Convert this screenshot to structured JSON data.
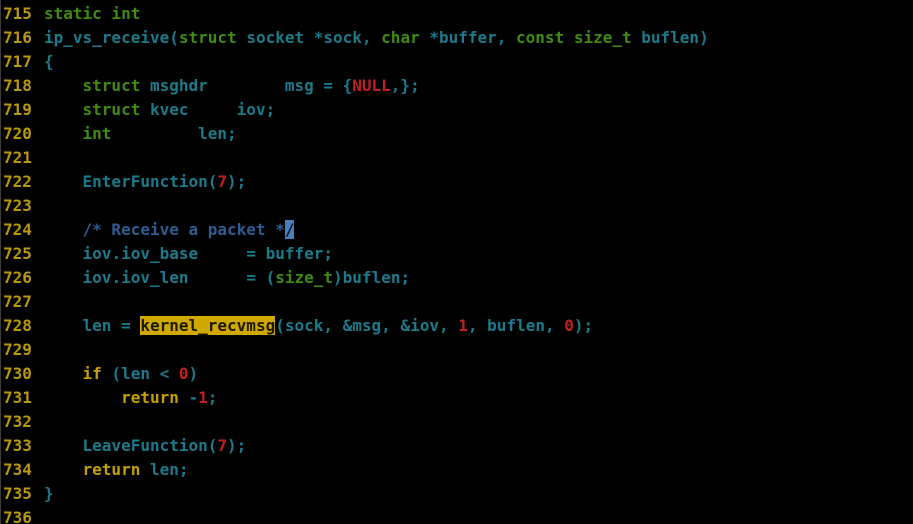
{
  "editor": {
    "app_kind": "terminal-code-viewer",
    "background_color": "#000000",
    "search_highlight_color": "#d0a800",
    "cursor_color": "#4a7ebb",
    "linenumber_color": "#b8980f",
    "search_term": "kernel_recvmsg",
    "cursor": {
      "line": 724,
      "column_char": "/"
    }
  },
  "lines": [
    {
      "num": "715",
      "tokens": [
        {
          "t": "static int",
          "c": "kw-type"
        }
      ]
    },
    {
      "num": "716",
      "tokens": [
        {
          "t": "ip_vs_receive",
          "c": "ident"
        },
        {
          "t": "(",
          "c": "punct"
        },
        {
          "t": "struct",
          "c": "kw-type"
        },
        {
          "t": " ",
          "c": "plain"
        },
        {
          "t": "socket",
          "c": "ident"
        },
        {
          "t": " *",
          "c": "plain"
        },
        {
          "t": "sock",
          "c": "ident"
        },
        {
          "t": ", ",
          "c": "punct"
        },
        {
          "t": "char",
          "c": "kw-type"
        },
        {
          "t": " *",
          "c": "plain"
        },
        {
          "t": "buffer",
          "c": "ident"
        },
        {
          "t": ", ",
          "c": "punct"
        },
        {
          "t": "const size_t",
          "c": "kw-type"
        },
        {
          "t": " ",
          "c": "plain"
        },
        {
          "t": "buflen",
          "c": "ident"
        },
        {
          "t": ")",
          "c": "punct"
        }
      ]
    },
    {
      "num": "717",
      "tokens": [
        {
          "t": "{",
          "c": "punct"
        }
      ]
    },
    {
      "num": "718",
      "tokens": [
        {
          "t": "    ",
          "c": "plain"
        },
        {
          "t": "struct",
          "c": "kw-type"
        },
        {
          "t": " ",
          "c": "plain"
        },
        {
          "t": "msghdr",
          "c": "ident"
        },
        {
          "t": "        ",
          "c": "plain"
        },
        {
          "t": "msg",
          "c": "ident"
        },
        {
          "t": " = {",
          "c": "punct"
        },
        {
          "t": "NULL",
          "c": "num"
        },
        {
          "t": ",};",
          "c": "punct"
        }
      ]
    },
    {
      "num": "719",
      "tokens": [
        {
          "t": "    ",
          "c": "plain"
        },
        {
          "t": "struct",
          "c": "kw-type"
        },
        {
          "t": " ",
          "c": "plain"
        },
        {
          "t": "kvec",
          "c": "ident"
        },
        {
          "t": "     ",
          "c": "plain"
        },
        {
          "t": "iov",
          "c": "ident"
        },
        {
          "t": ";",
          "c": "punct"
        }
      ]
    },
    {
      "num": "720",
      "tokens": [
        {
          "t": "    ",
          "c": "plain"
        },
        {
          "t": "int",
          "c": "kw-type"
        },
        {
          "t": "         ",
          "c": "plain"
        },
        {
          "t": "len",
          "c": "ident"
        },
        {
          "t": ";",
          "c": "punct"
        }
      ]
    },
    {
      "num": "721",
      "tokens": []
    },
    {
      "num": "722",
      "tokens": [
        {
          "t": "    ",
          "c": "plain"
        },
        {
          "t": "EnterFunction",
          "c": "ident"
        },
        {
          "t": "(",
          "c": "punct"
        },
        {
          "t": "7",
          "c": "num"
        },
        {
          "t": ");",
          "c": "punct"
        }
      ]
    },
    {
      "num": "723",
      "tokens": []
    },
    {
      "num": "724",
      "tokens": [
        {
          "t": "    ",
          "c": "plain"
        },
        {
          "t": "/* Receive a packet *",
          "c": "comment"
        },
        {
          "t": "/",
          "c": "cursor"
        }
      ]
    },
    {
      "num": "725",
      "tokens": [
        {
          "t": "    ",
          "c": "plain"
        },
        {
          "t": "iov",
          "c": "ident"
        },
        {
          "t": ".",
          "c": "punct"
        },
        {
          "t": "iov_base",
          "c": "ident"
        },
        {
          "t": "     = ",
          "c": "punct"
        },
        {
          "t": "buffer",
          "c": "ident"
        },
        {
          "t": ";",
          "c": "punct"
        }
      ]
    },
    {
      "num": "726",
      "tokens": [
        {
          "t": "    ",
          "c": "plain"
        },
        {
          "t": "iov",
          "c": "ident"
        },
        {
          "t": ".",
          "c": "punct"
        },
        {
          "t": "iov_len",
          "c": "ident"
        },
        {
          "t": "      = (",
          "c": "punct"
        },
        {
          "t": "size_t",
          "c": "kw-type"
        },
        {
          "t": ")",
          "c": "punct"
        },
        {
          "t": "buflen",
          "c": "ident"
        },
        {
          "t": ";",
          "c": "punct"
        }
      ]
    },
    {
      "num": "727",
      "tokens": []
    },
    {
      "num": "728",
      "tokens": [
        {
          "t": "    ",
          "c": "plain"
        },
        {
          "t": "len",
          "c": "ident"
        },
        {
          "t": " = ",
          "c": "punct"
        },
        {
          "t": "kernel_recvmsg",
          "c": "hl"
        },
        {
          "t": "(",
          "c": "punct"
        },
        {
          "t": "sock",
          "c": "ident"
        },
        {
          "t": ", &",
          "c": "punct"
        },
        {
          "t": "msg",
          "c": "ident"
        },
        {
          "t": ", &",
          "c": "punct"
        },
        {
          "t": "iov",
          "c": "ident"
        },
        {
          "t": ", ",
          "c": "punct"
        },
        {
          "t": "1",
          "c": "num"
        },
        {
          "t": ", ",
          "c": "punct"
        },
        {
          "t": "buflen",
          "c": "ident"
        },
        {
          "t": ", ",
          "c": "punct"
        },
        {
          "t": "0",
          "c": "num"
        },
        {
          "t": ");",
          "c": "punct"
        }
      ]
    },
    {
      "num": "729",
      "tokens": []
    },
    {
      "num": "730",
      "tokens": [
        {
          "t": "    ",
          "c": "plain"
        },
        {
          "t": "if",
          "c": "kw-ctrl"
        },
        {
          "t": " (",
          "c": "punct"
        },
        {
          "t": "len",
          "c": "ident"
        },
        {
          "t": " < ",
          "c": "punct"
        },
        {
          "t": "0",
          "c": "num"
        },
        {
          "t": ")",
          "c": "punct"
        }
      ]
    },
    {
      "num": "731",
      "tokens": [
        {
          "t": "        ",
          "c": "plain"
        },
        {
          "t": "return",
          "c": "kw-ctrl"
        },
        {
          "t": " -",
          "c": "punct"
        },
        {
          "t": "1",
          "c": "num"
        },
        {
          "t": ";",
          "c": "punct"
        }
      ]
    },
    {
      "num": "732",
      "tokens": []
    },
    {
      "num": "733",
      "tokens": [
        {
          "t": "    ",
          "c": "plain"
        },
        {
          "t": "LeaveFunction",
          "c": "ident"
        },
        {
          "t": "(",
          "c": "punct"
        },
        {
          "t": "7",
          "c": "num"
        },
        {
          "t": ");",
          "c": "punct"
        }
      ]
    },
    {
      "num": "734",
      "tokens": [
        {
          "t": "    ",
          "c": "plain"
        },
        {
          "t": "return",
          "c": "kw-ctrl"
        },
        {
          "t": " ",
          "c": "plain"
        },
        {
          "t": "len",
          "c": "ident"
        },
        {
          "t": ";",
          "c": "punct"
        }
      ]
    },
    {
      "num": "735",
      "tokens": [
        {
          "t": "}",
          "c": "punct"
        }
      ]
    },
    {
      "num": "736",
      "tokens": []
    }
  ]
}
